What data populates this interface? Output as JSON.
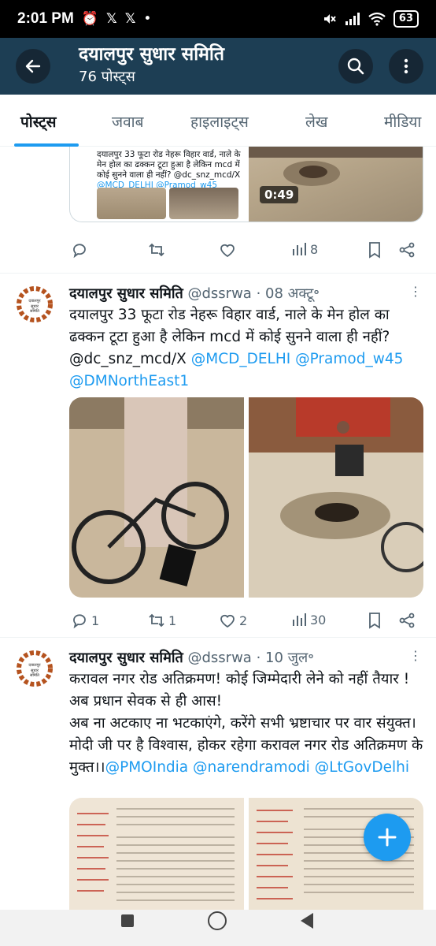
{
  "status_bar": {
    "time": "2:01 PM",
    "left_icons": [
      "alarm-off-icon",
      "x-logo-icon",
      "x-logo-icon",
      "dot-icon"
    ],
    "right_icons": [
      "mute-icon",
      "signal-icon",
      "wifi-icon"
    ],
    "battery": "63"
  },
  "header": {
    "title": "दयालपुर सुधार समिति",
    "subtitle": "76 पोस्ट्स",
    "bg_color": "#1d3e54"
  },
  "tabs": [
    {
      "label": "पोस्ट्स",
      "active": true
    },
    {
      "label": "जवाब",
      "active": false
    },
    {
      "label": "हाइलाइट्स",
      "active": false
    },
    {
      "label": "लेख",
      "active": false
    },
    {
      "label": "मीडिया",
      "active": false
    }
  ],
  "partial_tweet": {
    "quote_text_1": "दयालपुर 33 फूटा रोड नेहरू विहार वार्ड, नाले के मेन होल का ढक्कन टूटा हुआ है लेकिन mcd में कोई सुनने वाला ही नहीं?",
    "quote_text_2": "@dc_snz_mcd/X",
    "quote_links": "@MCD_DELHI @Pramod_w45 @DMNorthEast1",
    "video_duration": "0:49",
    "views": "8"
  },
  "tweets": [
    {
      "name": "दयालपुर सुधार समिति",
      "handle": "@dssrwa",
      "date": "· 08 अक्टू॰",
      "text_1": "दयालपुर 33 फूटा रोड नेहरू विहार वार्ड, नाले के मेन होल का ढक्कन टूटा हुआ है लेकिन mcd में कोई सुनने वाला ही नहीं?",
      "text_2": "@dc_snz_mcd/X",
      "mentions": "@MCD_DELHI @Pramod_w45",
      "mentions_2": "@DMNorthEast1",
      "replies": "1",
      "reposts": "1",
      "likes": "2",
      "views": "30"
    },
    {
      "name": "दयालपुर सुधार समिति",
      "handle": "@dssrwa",
      "date": "· 10 जुल॰",
      "text_1": "करावल नगर रोड अतिक्रमण! कोई जिम्मेदारी लेने को नहीं तैयार ! अब प्रधान सेवक से ही आस!",
      "text_2": "अब ना अटकाए ना भटकाएंगे, करेंगे सभी भ्रष्टाचार पर वार संयुक्त। मोदी जी पर है विश्वास, होकर रहेगा करावल नगर रोड अतिक्रमण के मुक्त।।",
      "mentions": "@PMOIndia @narendramodi",
      "mentions_2": "@LtGovDelhi"
    }
  ],
  "colors": {
    "accent": "#1d9bf0",
    "text": "#0f1419",
    "muted": "#536471"
  }
}
